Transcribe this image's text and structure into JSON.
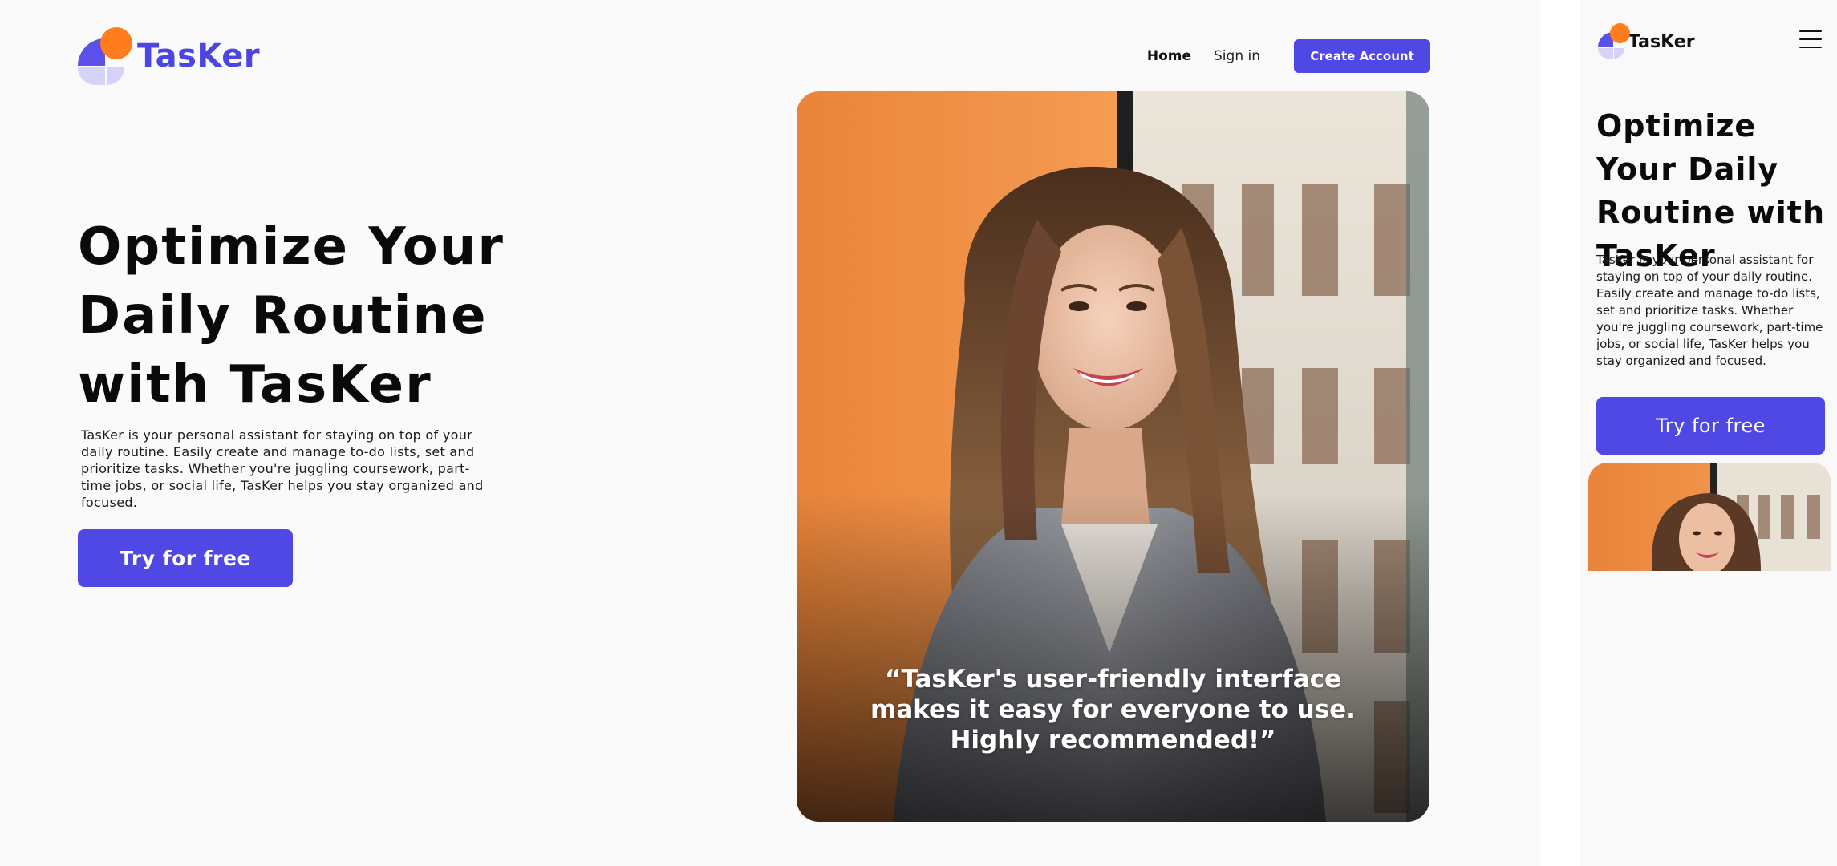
{
  "brand": {
    "name": "TasKer",
    "colors": {
      "primary": "#5048e5",
      "orange": "#ff7d1e",
      "lavender": "#d6d2f8"
    }
  },
  "nav": {
    "home": "Home",
    "signin": "Sign in",
    "create_account": "Create Account"
  },
  "hero": {
    "title_line1": "Optimize Your",
    "title_line2": "Daily Routine",
    "title_line3": "with TasKer",
    "description": "TasKer is your personal assistant for staying on top of your daily routine. Easily create and manage to-do lists, set and prioritize tasks. Whether you're juggling coursework, part-time jobs, or social life, TasKer helps you stay organized and focused.",
    "cta": "Try for free"
  },
  "testimonial": {
    "quote": "“TasKer's user-friendly interface makes it easy for everyone to use. Highly recommended!”"
  },
  "mobile": {
    "title": "Optimize Your Daily Routine with TasKer",
    "description": "TasKer is your personal assistant for staying on top of your daily routine. Easily create and manage to-do lists, set and prioritize tasks. Whether you're juggling coursework, part-time jobs, or social life, TasKer helps you stay organized and focused.",
    "cta": "Try for free",
    "menu_icon": "hamburger-menu-icon"
  }
}
